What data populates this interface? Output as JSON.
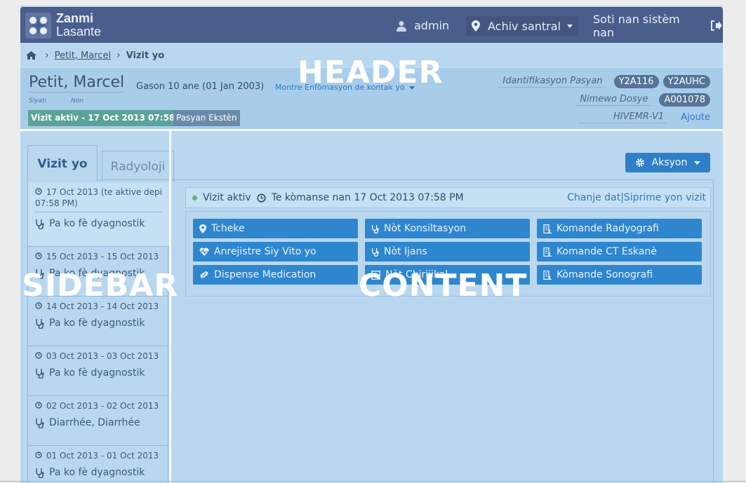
{
  "app": {
    "logo_line1": "Zanmi",
    "logo_line2": "Lasante",
    "user": "admin",
    "location": "Achiv santral",
    "logout": "Soti nan sistèm nan"
  },
  "breadcrumb": {
    "patient": "Petit, Marcel",
    "current": "Vizit yo"
  },
  "patient": {
    "name": "Petit, Marcel",
    "family_label": "Siyati",
    "given_label": "Non",
    "gender_age": "Gason  10 ane (01 Jan 2003)",
    "contact_link": "Montre Enfòmasyon de kontak yo",
    "active_visit_badge": "Vizit aktiv - 17 Oct 2013 07:58 PM",
    "external_badge": "Pasyan Ekstèn",
    "id_label": "Idantifikasyon Pasyan",
    "ids": [
      "Y2A116",
      "Y2AUHC"
    ],
    "dossier_label": "Nimewo Dosye",
    "dossier_number": "A001078",
    "hivemr_label": "HIVEMR-V1",
    "add_link": "Ajoute"
  },
  "tabs": {
    "visits": "Vizit yo",
    "radiology": "Radyoloji",
    "actions": "Aksyon"
  },
  "visits": [
    {
      "date": "17 Oct 2013 (te aktive depi 07:58 PM)",
      "diagnosis": "Pa ko fè dyagnostik"
    },
    {
      "date": "15 Oct 2013 - 15 Oct 2013",
      "diagnosis": "Pa ko fè dyagnostik"
    },
    {
      "date": "14 Oct 2013 - 14 Oct 2013",
      "diagnosis": "Pa ko fè dyagnostik"
    },
    {
      "date": "03 Oct 2013 - 03 Oct 2013",
      "diagnosis": "Pa ko fè dyagnostik"
    },
    {
      "date": "02 Oct 2013 - 02 Oct 2013",
      "diagnosis": "Diarrhée, Diarrhée"
    },
    {
      "date": "01 Oct 2013 - 01 Oct 2013",
      "diagnosis": "Pa ko fè dyagnostik"
    }
  ],
  "visit_header": {
    "status": "Vizit aktiv",
    "started": "Te kòmanse nan 17 Oct 2013 07:58 PM",
    "change_date": "Chanje dat",
    "separator": "|",
    "delete": "Siprime yon vizit"
  },
  "action_buttons": [
    {
      "label": "Tcheke",
      "icon": "map-marker-icon"
    },
    {
      "label": "Nòt Konsiltasyon",
      "icon": "stethoscope-icon"
    },
    {
      "label": "Komande Radyografi",
      "icon": "radiology-icon"
    },
    {
      "label": "Anrejistre Siy Vito yo",
      "icon": "heartbeat-icon"
    },
    {
      "label": "Nòt Ijans",
      "icon": "stethoscope-icon"
    },
    {
      "label": "Komande CT Eskanè",
      "icon": "radiology-icon"
    },
    {
      "label": "Dispense Medication",
      "icon": "pill-icon"
    },
    {
      "label": "Nòt Chirijikal",
      "icon": "surgery-icon"
    },
    {
      "label": "Kòmande Sonografi",
      "icon": "radiology-icon"
    }
  ],
  "overlay_labels": {
    "header": "HEADER",
    "sidebar": "SIDEBAR",
    "content": "CONTENT"
  },
  "colors": {
    "topbar": "#4a5e8c",
    "button": "#2e86cf",
    "overlay_tint": "#b9d7ee",
    "active_visit": "#5aa497"
  }
}
